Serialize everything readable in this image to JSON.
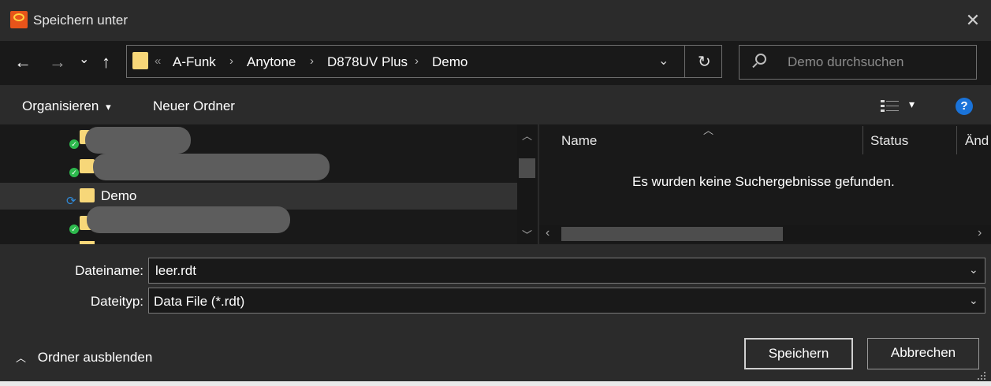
{
  "window": {
    "title": "Speichern unter",
    "close_glyph": "✕",
    "accent": "#e8541a"
  },
  "nav": {
    "back_glyph": "←",
    "forward_glyph": "→",
    "recent_glyph": "⌄",
    "up_glyph": "↑",
    "overflow_glyph": "«",
    "breadcrumbs": [
      "A-Funk",
      "Anytone",
      "D878UV Plus",
      "Demo"
    ],
    "separator": "›",
    "dropdown_glyph": "⌄",
    "refresh_glyph": "↻",
    "search_placeholder": "Demo durchsuchen"
  },
  "toolbar": {
    "organize_label": "Organisieren",
    "organize_chevron": "▾",
    "new_folder_label": "Neuer Ordner",
    "view_chevron": "▾",
    "help_label": "?"
  },
  "tree": {
    "selected_label": "Demo",
    "sync_glyph": "⟳",
    "ok_glyph": "✓",
    "scroll_up": "︿",
    "scroll_down": "﹀"
  },
  "filelist": {
    "columns": [
      "Name",
      "Status",
      "Änd"
    ],
    "sort_glyph": "︿",
    "empty_message": "Es wurden keine Suchergebnisse gefunden.",
    "scroll_left": "‹",
    "scroll_right": "›"
  },
  "form": {
    "filename_label": "Dateiname:",
    "filename_value": "leer.rdt",
    "filetype_label": "Dateityp:",
    "filetype_value": "Data File (*.rdt)",
    "chevron": "⌄"
  },
  "footer": {
    "hide_folders_glyph": "︿",
    "hide_folders_label": "Ordner ausblenden",
    "save_label": "Speichern",
    "cancel_label": "Abbrechen"
  }
}
